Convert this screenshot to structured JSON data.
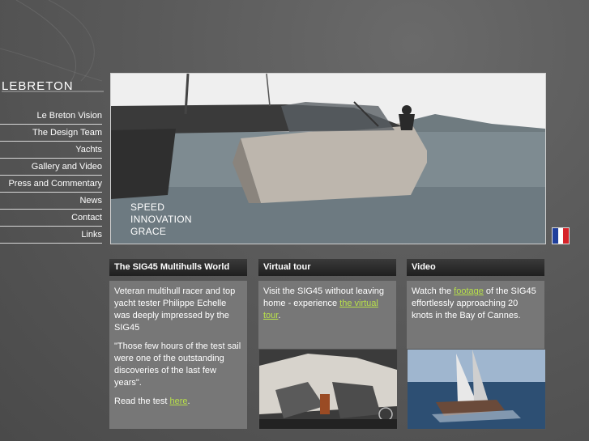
{
  "brand": {
    "logo_text": "LEBRETON"
  },
  "nav": {
    "items": [
      {
        "label": "Le Breton Vision"
      },
      {
        "label": "The Design Team"
      },
      {
        "label": "Yachts"
      },
      {
        "label": "Gallery and Video"
      },
      {
        "label": "Press and Commentary"
      },
      {
        "label": "News"
      },
      {
        "label": "Contact"
      },
      {
        "label": "Links"
      }
    ]
  },
  "hero": {
    "caption_lines": [
      "SPEED",
      "INNOVATION",
      "GRACE"
    ]
  },
  "language": {
    "flag_colors": [
      "#1f3f9c",
      "#ffffff",
      "#d6232a"
    ],
    "icon": "france-flag-icon"
  },
  "panels": {
    "world": {
      "title": "The SIG45 Multihulls World",
      "p1": "Veteran multihull racer and top yacht tester Philippe Echelle was deeply impressed by the SIG45",
      "p2": "\"Those few hours of the test sail were one of the outstanding discoveries of the last few years\".",
      "p3_before": "Read the test ",
      "p3_link": "here",
      "p3_after": "."
    },
    "tour": {
      "title": "Virtual tour",
      "p1_before": "Visit the SIG45 without leaving home - experience ",
      "p1_link": "the virtual tour",
      "p1_after": "."
    },
    "video": {
      "title": "Video",
      "p1_before": "Watch the ",
      "p1_link": "footage",
      "p1_after": " of the SIG45 effortlessly approaching 20 knots in the Bay of Cannes."
    }
  },
  "colors": {
    "link": "#b8e04a",
    "panel_bg": "#777777",
    "panel_head": "#1f1f1f"
  }
}
